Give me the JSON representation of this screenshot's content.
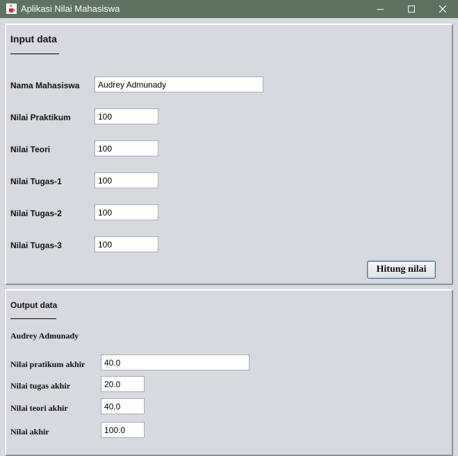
{
  "window": {
    "title": "Aplikasi Nilai Mahasiswa",
    "icon": "java-cup-icon"
  },
  "input_panel": {
    "heading": "Input data",
    "fields": [
      {
        "label": "Nama Mahasiswa",
        "value": "Audrey Admunady"
      },
      {
        "label": "Nilai Praktikum",
        "value": "100"
      },
      {
        "label": "Nilai Teori",
        "value": "100"
      },
      {
        "label": "Nilai Tugas-1",
        "value": "100"
      },
      {
        "label": "Nilai Tugas-2",
        "value": "100"
      },
      {
        "label": "Nilai Tugas-3",
        "value": "100"
      }
    ],
    "button_label": "Hitung nilai"
  },
  "output_panel": {
    "heading": "Output data",
    "student_name": "Audrey Admunady",
    "results": [
      {
        "label": "Nilai pratikum akhir",
        "value": "40.0"
      },
      {
        "label": "Nilai tugas akhir",
        "value": "20.0"
      },
      {
        "label": "Nilai teori akhir",
        "value": "40.0"
      },
      {
        "label": "Nilai akhir",
        "value": "100.0"
      }
    ]
  },
  "colors": {
    "titlebar": "#5e7260",
    "background": "#d6d9df",
    "button_border": "#4a6e96"
  }
}
